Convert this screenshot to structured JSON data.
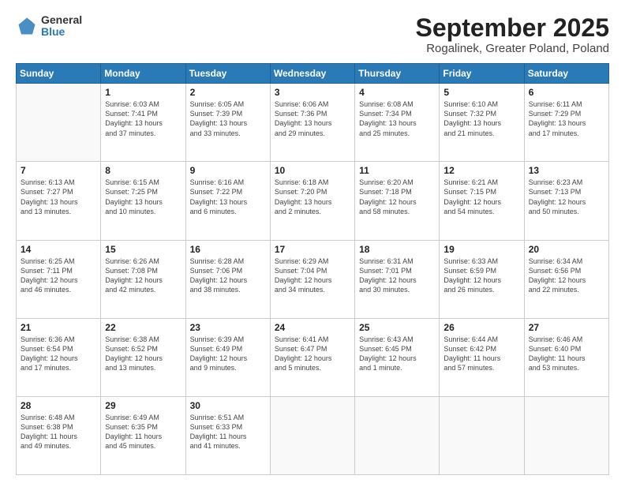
{
  "logo": {
    "general": "General",
    "blue": "Blue"
  },
  "header": {
    "month": "September 2025",
    "location": "Rogalinek, Greater Poland, Poland"
  },
  "weekdays": [
    "Sunday",
    "Monday",
    "Tuesday",
    "Wednesday",
    "Thursday",
    "Friday",
    "Saturday"
  ],
  "weeks": [
    [
      {
        "day": "",
        "text": ""
      },
      {
        "day": "1",
        "text": "Sunrise: 6:03 AM\nSunset: 7:41 PM\nDaylight: 13 hours\nand 37 minutes."
      },
      {
        "day": "2",
        "text": "Sunrise: 6:05 AM\nSunset: 7:39 PM\nDaylight: 13 hours\nand 33 minutes."
      },
      {
        "day": "3",
        "text": "Sunrise: 6:06 AM\nSunset: 7:36 PM\nDaylight: 13 hours\nand 29 minutes."
      },
      {
        "day": "4",
        "text": "Sunrise: 6:08 AM\nSunset: 7:34 PM\nDaylight: 13 hours\nand 25 minutes."
      },
      {
        "day": "5",
        "text": "Sunrise: 6:10 AM\nSunset: 7:32 PM\nDaylight: 13 hours\nand 21 minutes."
      },
      {
        "day": "6",
        "text": "Sunrise: 6:11 AM\nSunset: 7:29 PM\nDaylight: 13 hours\nand 17 minutes."
      }
    ],
    [
      {
        "day": "7",
        "text": "Sunrise: 6:13 AM\nSunset: 7:27 PM\nDaylight: 13 hours\nand 13 minutes."
      },
      {
        "day": "8",
        "text": "Sunrise: 6:15 AM\nSunset: 7:25 PM\nDaylight: 13 hours\nand 10 minutes."
      },
      {
        "day": "9",
        "text": "Sunrise: 6:16 AM\nSunset: 7:22 PM\nDaylight: 13 hours\nand 6 minutes."
      },
      {
        "day": "10",
        "text": "Sunrise: 6:18 AM\nSunset: 7:20 PM\nDaylight: 13 hours\nand 2 minutes."
      },
      {
        "day": "11",
        "text": "Sunrise: 6:20 AM\nSunset: 7:18 PM\nDaylight: 12 hours\nand 58 minutes."
      },
      {
        "day": "12",
        "text": "Sunrise: 6:21 AM\nSunset: 7:15 PM\nDaylight: 12 hours\nand 54 minutes."
      },
      {
        "day": "13",
        "text": "Sunrise: 6:23 AM\nSunset: 7:13 PM\nDaylight: 12 hours\nand 50 minutes."
      }
    ],
    [
      {
        "day": "14",
        "text": "Sunrise: 6:25 AM\nSunset: 7:11 PM\nDaylight: 12 hours\nand 46 minutes."
      },
      {
        "day": "15",
        "text": "Sunrise: 6:26 AM\nSunset: 7:08 PM\nDaylight: 12 hours\nand 42 minutes."
      },
      {
        "day": "16",
        "text": "Sunrise: 6:28 AM\nSunset: 7:06 PM\nDaylight: 12 hours\nand 38 minutes."
      },
      {
        "day": "17",
        "text": "Sunrise: 6:29 AM\nSunset: 7:04 PM\nDaylight: 12 hours\nand 34 minutes."
      },
      {
        "day": "18",
        "text": "Sunrise: 6:31 AM\nSunset: 7:01 PM\nDaylight: 12 hours\nand 30 minutes."
      },
      {
        "day": "19",
        "text": "Sunrise: 6:33 AM\nSunset: 6:59 PM\nDaylight: 12 hours\nand 26 minutes."
      },
      {
        "day": "20",
        "text": "Sunrise: 6:34 AM\nSunset: 6:56 PM\nDaylight: 12 hours\nand 22 minutes."
      }
    ],
    [
      {
        "day": "21",
        "text": "Sunrise: 6:36 AM\nSunset: 6:54 PM\nDaylight: 12 hours\nand 17 minutes."
      },
      {
        "day": "22",
        "text": "Sunrise: 6:38 AM\nSunset: 6:52 PM\nDaylight: 12 hours\nand 13 minutes."
      },
      {
        "day": "23",
        "text": "Sunrise: 6:39 AM\nSunset: 6:49 PM\nDaylight: 12 hours\nand 9 minutes."
      },
      {
        "day": "24",
        "text": "Sunrise: 6:41 AM\nSunset: 6:47 PM\nDaylight: 12 hours\nand 5 minutes."
      },
      {
        "day": "25",
        "text": "Sunrise: 6:43 AM\nSunset: 6:45 PM\nDaylight: 12 hours\nand 1 minute."
      },
      {
        "day": "26",
        "text": "Sunrise: 6:44 AM\nSunset: 6:42 PM\nDaylight: 11 hours\nand 57 minutes."
      },
      {
        "day": "27",
        "text": "Sunrise: 6:46 AM\nSunset: 6:40 PM\nDaylight: 11 hours\nand 53 minutes."
      }
    ],
    [
      {
        "day": "28",
        "text": "Sunrise: 6:48 AM\nSunset: 6:38 PM\nDaylight: 11 hours\nand 49 minutes."
      },
      {
        "day": "29",
        "text": "Sunrise: 6:49 AM\nSunset: 6:35 PM\nDaylight: 11 hours\nand 45 minutes."
      },
      {
        "day": "30",
        "text": "Sunrise: 6:51 AM\nSunset: 6:33 PM\nDaylight: 11 hours\nand 41 minutes."
      },
      {
        "day": "",
        "text": ""
      },
      {
        "day": "",
        "text": ""
      },
      {
        "day": "",
        "text": ""
      },
      {
        "day": "",
        "text": ""
      }
    ]
  ]
}
